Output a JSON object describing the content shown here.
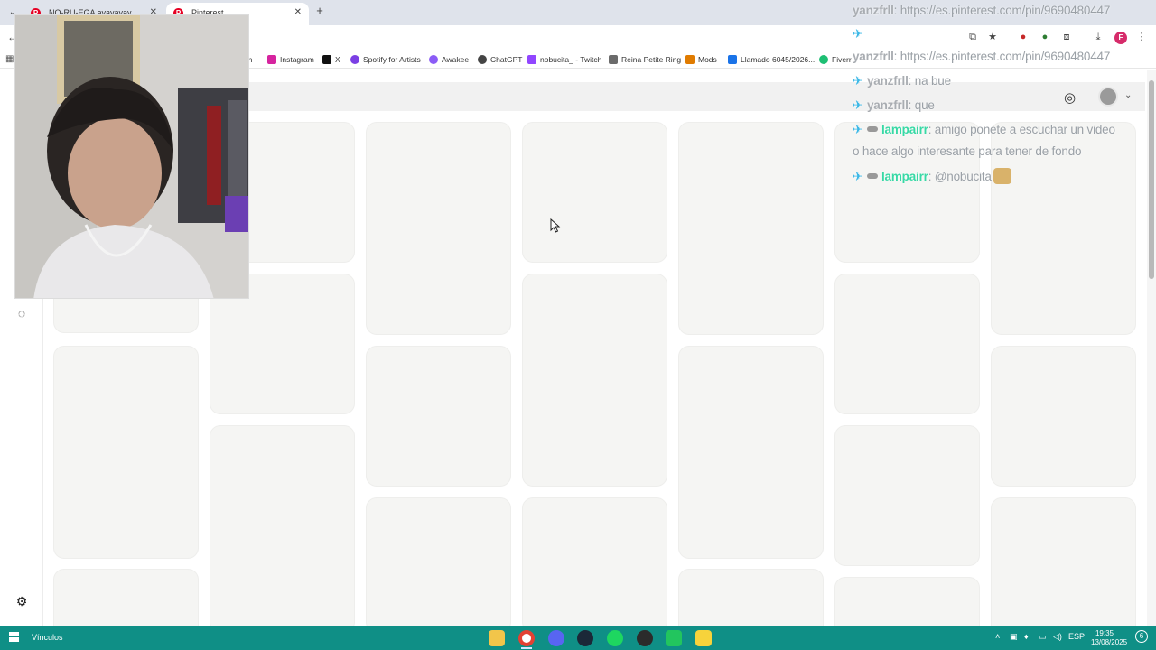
{
  "browser": {
    "tabs": [
      {
        "title": "NO-RU-EGA ayayayay",
        "active": false
      },
      {
        "title": "Pinterest",
        "active": true
      }
    ],
    "bookmarks": [
      {
        "label": "tch",
        "color": "#9146ff"
      },
      {
        "label": "Instagram",
        "color": "#d6249f"
      },
      {
        "label": "X",
        "color": "#111111"
      },
      {
        "label": "Spotify for Artists",
        "color": "#7b3fe4"
      },
      {
        "label": "Awakee",
        "color": "#8b5cf6"
      },
      {
        "label": "ChatGPT",
        "color": "#444444"
      },
      {
        "label": "nobucita_ - Twitch",
        "color": "#9146ff"
      },
      {
        "label": "Reina Petite Ring",
        "color": "#6b6b6b"
      },
      {
        "label": "Mods",
        "color": "#e07b00"
      },
      {
        "label": "Llamado 6045/2026...",
        "color": "#1a73e8"
      },
      {
        "label": "Fiverr",
        "color": "#1dbf73"
      }
    ],
    "profile_initial": "F"
  },
  "icons": {
    "menu": "chevron-down-icon",
    "close": "close-icon",
    "new_tab": "plus-icon",
    "back": "back-arrow-icon",
    "install": "install-app-icon",
    "star": "star-icon",
    "extensions": "puzzle-icon",
    "download": "download-icon",
    "more": "more-vert-icon",
    "camera": "camera-icon",
    "messages": "chat-bubble-icon",
    "settings": "gear-icon",
    "apps": "apps-grid-icon"
  },
  "chat": [
    {
      "user": "yanzfrll",
      "text": "https://es.pinterest.com/pin/9690480447",
      "color": "#a9adb2"
    },
    {
      "user": "yanzfrll",
      "text": "https://es.pinterest.com/pin/9690480447",
      "color": "#a9adb2"
    },
    {
      "user": "yanzfrll",
      "text": "na bue",
      "color": "#a9adb2"
    },
    {
      "user": "yanzfrll",
      "text": "que",
      "color": "#a9adb2"
    },
    {
      "user": "lampairr",
      "text": "amigo ponete a escuchar un video",
      "color": "#37d9a5"
    },
    {
      "user": "",
      "text": "o hace algo interesante para tener de fondo",
      "color": "#a9adb2"
    },
    {
      "user": "lampairr",
      "text": "@nobucita",
      "color": "#37d9a5"
    }
  ],
  "taskbar": {
    "label": "Vínculos",
    "language": "ESP",
    "time": "19:35",
    "date": "13/08/2025",
    "notifications": "6",
    "accent": "#0f8f86"
  }
}
